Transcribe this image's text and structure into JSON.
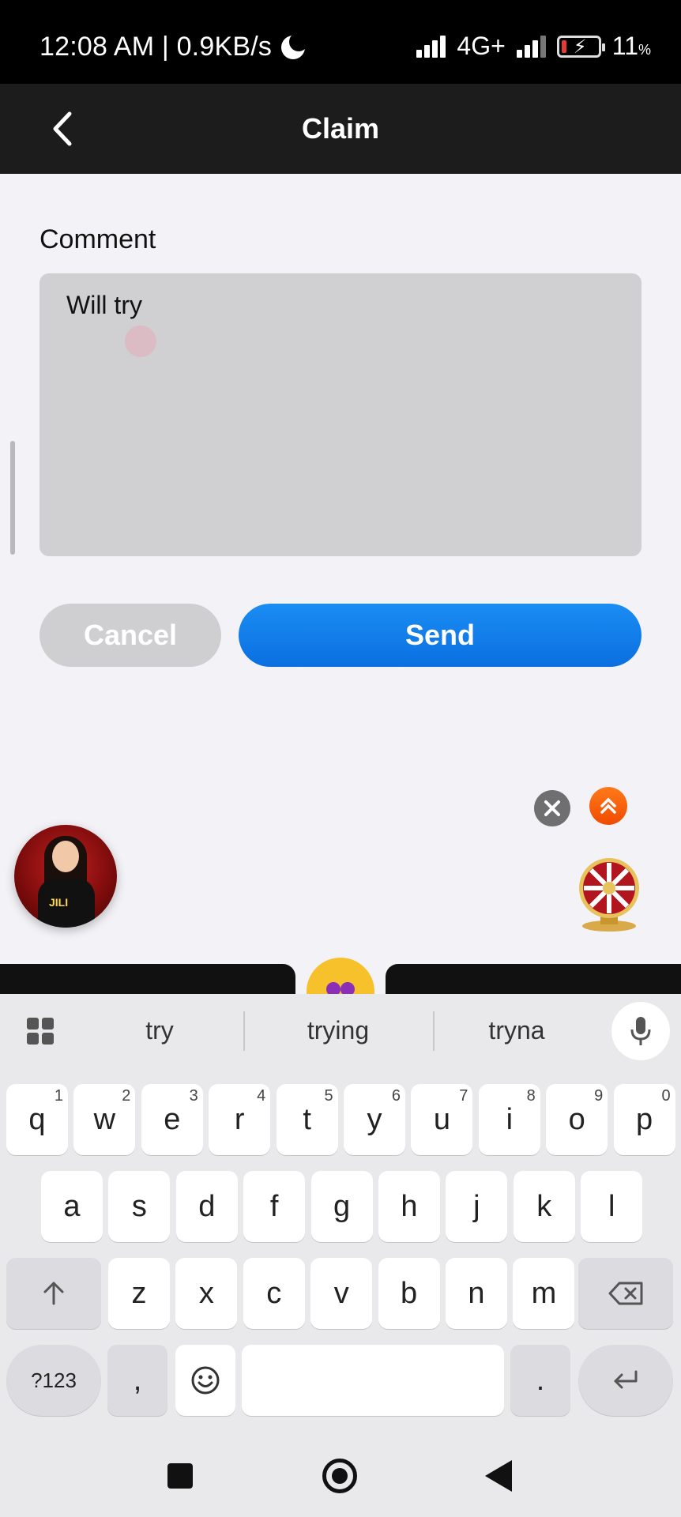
{
  "status_bar": {
    "time_speed": "12:08 AM | 0.9KB/s",
    "network": "4G+",
    "battery_level": "11",
    "battery_unit": "%"
  },
  "header": {
    "title": "Claim"
  },
  "form": {
    "label": "Comment",
    "value": "Will try",
    "cancel_label": "Cancel",
    "send_label": "Send"
  },
  "avatar_badge": "JILI",
  "keyboard": {
    "suggestions": [
      "try",
      "trying",
      "tryna"
    ],
    "row1": [
      {
        "k": "q",
        "h": "1"
      },
      {
        "k": "w",
        "h": "2"
      },
      {
        "k": "e",
        "h": "3"
      },
      {
        "k": "r",
        "h": "4"
      },
      {
        "k": "t",
        "h": "5"
      },
      {
        "k": "y",
        "h": "6"
      },
      {
        "k": "u",
        "h": "7"
      },
      {
        "k": "i",
        "h": "8"
      },
      {
        "k": "o",
        "h": "9"
      },
      {
        "k": "p",
        "h": "0"
      }
    ],
    "row2": [
      "a",
      "s",
      "d",
      "f",
      "g",
      "h",
      "j",
      "k",
      "l"
    ],
    "row3": [
      "z",
      "x",
      "c",
      "v",
      "b",
      "n",
      "m"
    ],
    "symbols_label": "?123",
    "comma_label": ",",
    "period_label": "."
  },
  "colors": {
    "accent": "#0b7ae8",
    "cancel": "#cfcfd2",
    "header_bg": "#1c1c1c"
  }
}
